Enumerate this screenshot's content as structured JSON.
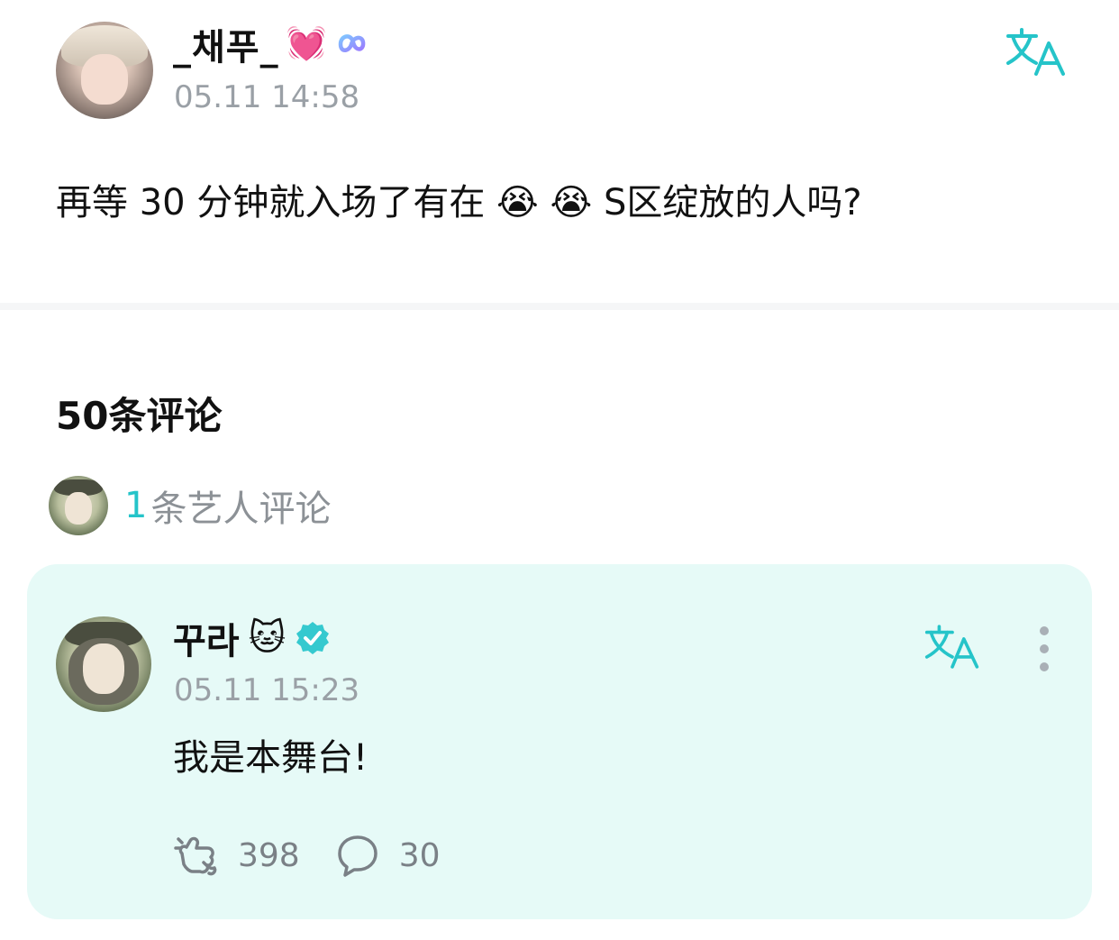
{
  "post": {
    "author": "_채푸_",
    "author_emoji": "💓",
    "badge_icon": "infinity-badge-icon",
    "time": "05.11 14:58",
    "body_part1": "再等 30 分钟就入场了有在",
    "body_emoji1": "😭",
    "body_emoji2": "😭",
    "body_part2": "S区绽放的人吗?",
    "translate_icon": "translate-icon"
  },
  "comments": {
    "title": "50条评论",
    "artist_count": "1",
    "artist_label": "条艺人评论"
  },
  "artist_comment": {
    "author": "꾸라",
    "author_emoji": "🐱",
    "verified_icon": "verified-check-icon",
    "time": "05.11 15:23",
    "text": "我是本舞台!",
    "likes": "398",
    "replies": "30",
    "like_icon": "like-icon",
    "reply_icon": "reply-bubble-icon",
    "more_icon": "more-vertical-icon"
  },
  "colors": {
    "accent": "#25c4c9",
    "card_bg": "#e6faf7",
    "muted": "#9aa0a6"
  }
}
